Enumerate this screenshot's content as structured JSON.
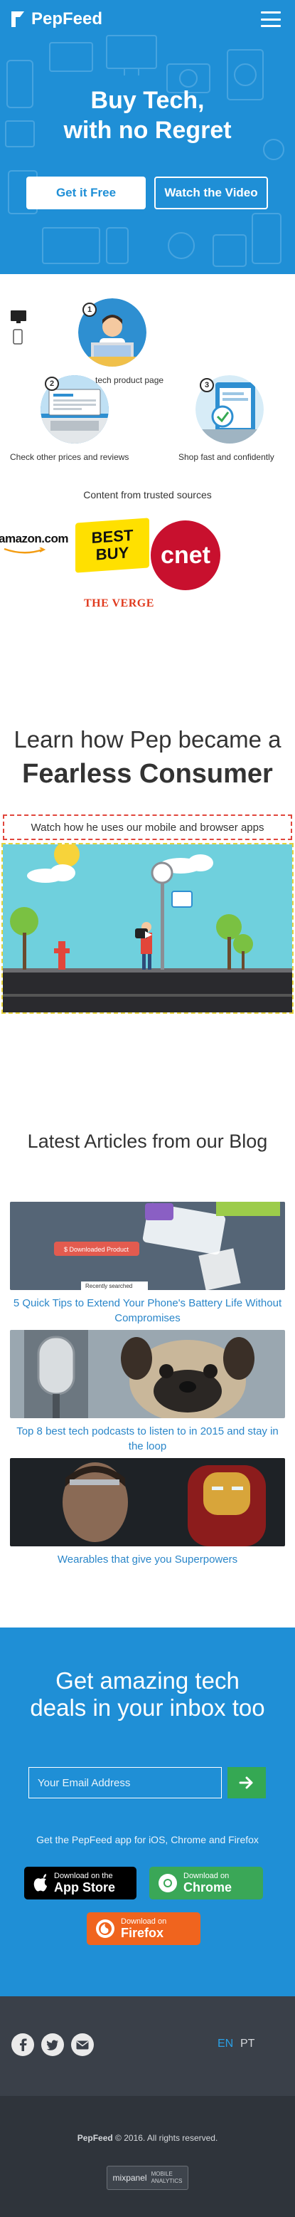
{
  "header": {
    "brand": "PepFeed"
  },
  "hero": {
    "title_line1": "Buy Tech,",
    "title_line2": "with no Regret",
    "primary_button": "Get it Free",
    "secondary_button": "Watch the Video"
  },
  "how_it_works": {
    "steps": [
      {
        "number": "1",
        "caption": "tech product page"
      },
      {
        "number": "2",
        "caption": "Check other prices and reviews"
      },
      {
        "number": "3",
        "caption": "Shop fast and confidently"
      }
    ],
    "trusted_label": "Content from trusted sources",
    "sources": [
      "amazon.com",
      "BEST BUY",
      "cnet",
      "THE VERGE"
    ]
  },
  "pep_section": {
    "title_line1": "Learn how Pep became a",
    "title_line2": "Fearless Consumer",
    "subtitle": "Watch how he uses our mobile and browser apps"
  },
  "blog": {
    "title": "Latest Articles from our Blog",
    "articles": [
      {
        "title": "5 Quick Tips to Extend Your Phone's Battery Life Without Compromises",
        "image_tags": [
          "$ Downloaded Product",
          "Recently searched"
        ]
      },
      {
        "title": "Top 8 best tech podcasts to listen to in 2015 and stay in the loop"
      },
      {
        "title": "Wearables that give you Superpowers"
      }
    ]
  },
  "newsletter": {
    "title": "Get amazing tech deals in your inbox too",
    "email_placeholder": "Your Email Address",
    "apps_text": "Get the PepFeed app for iOS, Chrome and Firefox",
    "app_store": {
      "small": "Download on the",
      "big": "App Store",
      "color": "#000000"
    },
    "chrome": {
      "small": "Download on",
      "big": "Chrome",
      "color": "#3aa757"
    },
    "firefox": {
      "small": "Download on",
      "big": "Firefox",
      "color": "#f0641e"
    }
  },
  "footer": {
    "social_icons": [
      "facebook-icon",
      "twitter-icon",
      "mail-icon"
    ],
    "languages": [
      {
        "code": "EN",
        "active": true
      },
      {
        "code": "PT",
        "active": false
      }
    ],
    "copyright_brand": "PepFeed",
    "copyright_text": "© 2016. All rights reserved.",
    "mixpanel_badge": {
      "brand": "mixpanel",
      "line1": "MOBILE",
      "line2": "ANALYTICS"
    }
  },
  "colors": {
    "primary_blue": "#1f8fd6",
    "link_blue": "#2a86c9",
    "footer_dark": "#3a4049",
    "footer_darker": "#2f343b",
    "submit_green": "#35a853"
  }
}
